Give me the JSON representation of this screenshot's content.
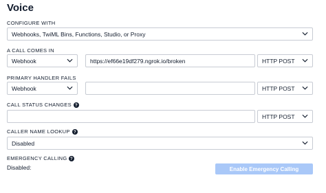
{
  "section": {
    "title": "Voice"
  },
  "configure_with": {
    "label": "CONFIGURE WITH",
    "value": "Webhooks, TwiML Bins, Functions, Studio, or Proxy"
  },
  "call_comes_in": {
    "label": "A CALL COMES IN",
    "type_value": "Webhook",
    "url_value": "https://ef66e19df279.ngrok.io/broken",
    "method_value": "HTTP POST"
  },
  "primary_handler_fails": {
    "label": "PRIMARY HANDLER FAILS",
    "type_value": "Webhook",
    "url_value": "",
    "method_value": "HTTP POST"
  },
  "call_status_changes": {
    "label": "CALL STATUS CHANGES",
    "url_value": "",
    "method_value": "HTTP POST"
  },
  "caller_name_lookup": {
    "label": "CALLER NAME LOOKUP",
    "value": "Disabled"
  },
  "emergency_calling": {
    "label": "EMERGENCY CALLING",
    "status": "Disabled:",
    "button_label": "Enable Emergency Calling"
  }
}
